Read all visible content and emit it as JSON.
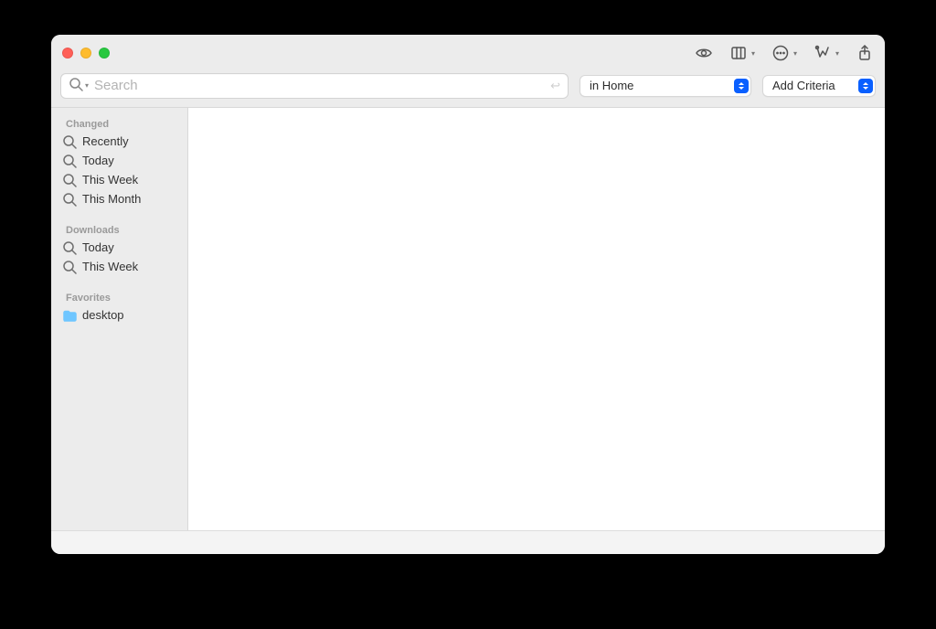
{
  "search": {
    "placeholder": "Search"
  },
  "scope_dropdown": {
    "label": "in Home"
  },
  "criteria_dropdown": {
    "label": "Add Criteria"
  },
  "sidebar": {
    "sections": [
      {
        "title": "Changed",
        "items": [
          {
            "label": "Recently",
            "icon": "search"
          },
          {
            "label": "Today",
            "icon": "search"
          },
          {
            "label": "This Week",
            "icon": "search"
          },
          {
            "label": "This Month",
            "icon": "search"
          }
        ]
      },
      {
        "title": "Downloads",
        "items": [
          {
            "label": "Today",
            "icon": "search"
          },
          {
            "label": "This Week",
            "icon": "search"
          }
        ]
      },
      {
        "title": "Favorites",
        "items": [
          {
            "label": "desktop",
            "icon": "folder"
          }
        ]
      }
    ]
  }
}
